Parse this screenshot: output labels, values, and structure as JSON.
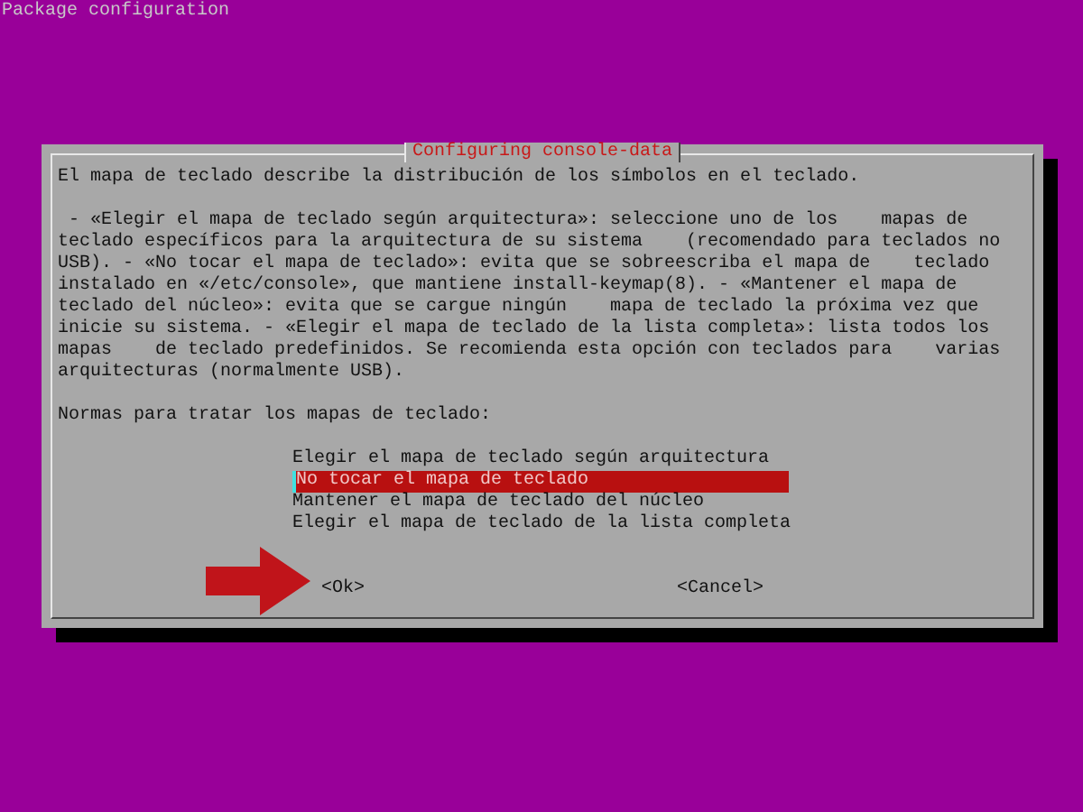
{
  "window": {
    "title": "Package configuration"
  },
  "dialog": {
    "title": "Configuring console-data",
    "intro": "El mapa de teclado describe la distribución de los símbolos en el teclado.",
    "description": " - «Elegir el mapa de teclado según arquitectura»: seleccione uno de los    mapas de\nteclado específicos para la arquitectura de su sistema    (recomendado para teclados no\nUSB). - «No tocar el mapa de teclado»: evita que se sobreescriba el mapa de    teclado\ninstalado en «/etc/console», que mantiene install-keymap(8). - «Mantener el mapa de\nteclado del núcleo»: evita que se cargue ningún    mapa de teclado la próxima vez que\ninicie su sistema. - «Elegir el mapa de teclado de la lista completa»: lista todos los\nmapas    de teclado predefinidos. Se recomienda esta opción con teclados para    varias\narquitecturas (normalmente USB).",
    "prompt": "Normas para tratar los mapas de teclado:",
    "options": [
      {
        "label": "Elegir el mapa de teclado según arquitectura",
        "selected": false
      },
      {
        "label": "No tocar el mapa de teclado",
        "selected": true
      },
      {
        "label": "Mantener el mapa de teclado del núcleo",
        "selected": false
      },
      {
        "label": "Elegir el mapa de teclado de la lista completa",
        "selected": false
      }
    ],
    "buttons": [
      "<Ok>",
      "<Cancel>"
    ]
  }
}
